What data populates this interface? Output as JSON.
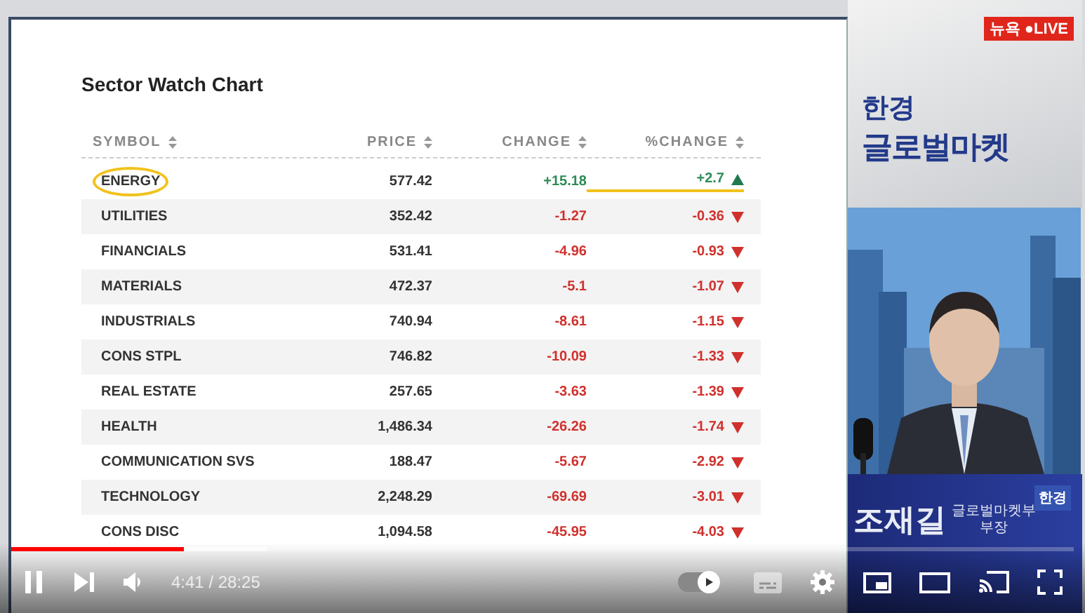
{
  "slide": {
    "title": "Sector Watch Chart",
    "columns": [
      {
        "label": "SYMBOL"
      },
      {
        "label": "PRICE"
      },
      {
        "label": "CHANGE"
      },
      {
        "label": "%CHANGE"
      }
    ],
    "rows": [
      {
        "symbol": "ENERGY",
        "price": "577.42",
        "change": "+15.18",
        "pct_change": "+2.7",
        "rising": true,
        "annotated": true
      },
      {
        "symbol": "UTILITIES",
        "price": "352.42",
        "change": "-1.27",
        "pct_change": "-0.36",
        "rising": false,
        "annotated": false
      },
      {
        "symbol": "FINANCIALS",
        "price": "531.41",
        "change": "-4.96",
        "pct_change": "-0.93",
        "rising": false,
        "annotated": false
      },
      {
        "symbol": "MATERIALS",
        "price": "472.37",
        "change": "-5.1",
        "pct_change": "-1.07",
        "rising": false,
        "annotated": false
      },
      {
        "symbol": "INDUSTRIALS",
        "price": "740.94",
        "change": "-8.61",
        "pct_change": "-1.15",
        "rising": false,
        "annotated": false
      },
      {
        "symbol": "CONS STPL",
        "price": "746.82",
        "change": "-10.09",
        "pct_change": "-1.33",
        "rising": false,
        "annotated": false
      },
      {
        "symbol": "REAL ESTATE",
        "price": "257.65",
        "change": "-3.63",
        "pct_change": "-1.39",
        "rising": false,
        "annotated": false
      },
      {
        "symbol": "HEALTH",
        "price": "1,486.34",
        "change": "-26.26",
        "pct_change": "-1.74",
        "rising": false,
        "annotated": false
      },
      {
        "symbol": "COMMUNICATION SVS",
        "price": "188.47",
        "change": "-5.67",
        "pct_change": "-2.92",
        "rising": false,
        "annotated": false
      },
      {
        "symbol": "TECHNOLOGY",
        "price": "2,248.29",
        "change": "-69.69",
        "pct_change": "-3.01",
        "rising": false,
        "annotated": false
      },
      {
        "symbol": "CONS DISC",
        "price": "1,094.58",
        "change": "-45.95",
        "pct_change": "-4.03",
        "rising": false,
        "annotated": false
      }
    ]
  },
  "broadcast": {
    "live_badge": "뉴욕 ●LIVE",
    "logo_top": "한경",
    "logo_main": "글로벌마켓",
    "name": "조재길",
    "department": "글로벌마켓부",
    "position": "부장",
    "corner_logo": "한경"
  },
  "player": {
    "progress": {
      "level": 0.163
    },
    "buffer": {
      "level": 0.24
    },
    "playing": true,
    "time": "4:41 / 28:25",
    "autoplay": true,
    "captions_available": false
  }
}
